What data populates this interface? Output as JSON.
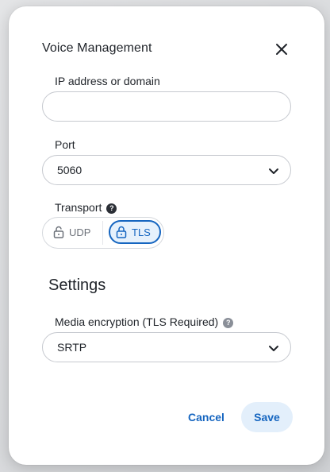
{
  "dialog": {
    "title": "Voice Management",
    "close_icon": "close-icon"
  },
  "fields": {
    "ip_address": {
      "label": "IP address or domain",
      "value": "",
      "placeholder": ""
    },
    "port": {
      "label": "Port",
      "selected": "5060",
      "icon": "chevron-down-icon"
    },
    "transport": {
      "label": "Transport",
      "help_icon": "help-circle-icon",
      "options": [
        {
          "label": "UDP",
          "icon": "unlock-icon",
          "selected": false
        },
        {
          "label": "TLS",
          "icon": "lock-icon",
          "selected": true
        }
      ]
    }
  },
  "settings": {
    "title": "Settings",
    "media_encryption": {
      "label": "Media encryption (TLS Required)",
      "help_icon": "help-circle-icon",
      "selected": "SRTP",
      "icon": "chevron-down-icon"
    }
  },
  "actions": {
    "cancel_label": "Cancel",
    "save_label": "Save"
  },
  "colors": {
    "accent": "#1565c0",
    "accent_soft": "#e3effb",
    "text": "#1f2329",
    "border": "#c6c9cf",
    "help_dark": "#2b2f36",
    "help_gray": "#8a8f98"
  }
}
